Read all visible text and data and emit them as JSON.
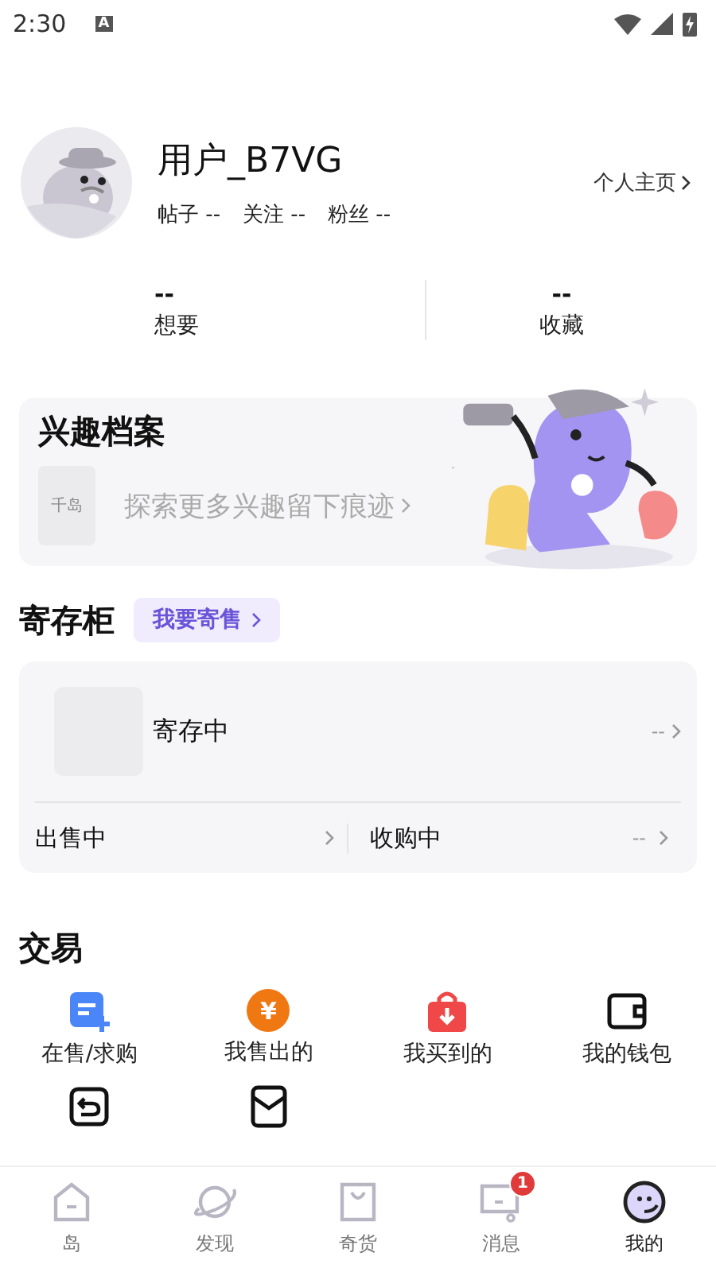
{
  "status_bar": {
    "time": "2:30",
    "badge": "A"
  },
  "profile": {
    "name": "用户_B7VG",
    "link": "个人主页",
    "stats": [
      {
        "label": "帖子",
        "value": "--"
      },
      {
        "label": "关注",
        "value": "--"
      },
      {
        "label": "粉丝",
        "value": "--"
      }
    ]
  },
  "counters": [
    {
      "value": "--",
      "label": "想要"
    },
    {
      "value": "--",
      "label": "收藏"
    }
  ],
  "interest": {
    "title": "兴趣档案",
    "thumb_text": "千岛",
    "prompt": "探索更多兴趣留下痕迹"
  },
  "storage": {
    "title": "寄存柜",
    "action": "我要寄售",
    "main": {
      "label": "寄存中",
      "value": "--"
    },
    "sub": [
      {
        "label": "出售中"
      },
      {
        "label": "收购中",
        "value": "--"
      }
    ]
  },
  "trade": {
    "title": "交易",
    "items": [
      {
        "kind": "post",
        "label": "在售/求购"
      },
      {
        "kind": "yuan",
        "glyph": "¥",
        "label": "我售出的"
      },
      {
        "kind": "bag",
        "label": "我买到的"
      },
      {
        "kind": "wallet",
        "label": "我的钱包"
      },
      {
        "kind": "return"
      },
      {
        "kind": "envelope"
      }
    ]
  },
  "nav": [
    {
      "kind": "home",
      "label": "岛",
      "selected": false
    },
    {
      "kind": "planet",
      "label": "发现",
      "selected": false
    },
    {
      "kind": "bag",
      "label": "奇货",
      "selected": false
    },
    {
      "kind": "message",
      "label": "消息",
      "selected": false,
      "badge": "1"
    },
    {
      "kind": "me",
      "label": "我的",
      "selected": true
    }
  ]
}
